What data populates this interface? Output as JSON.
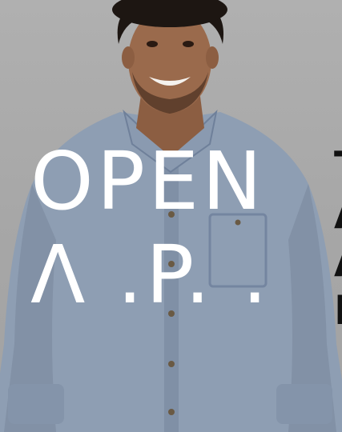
{
  "image": {
    "subject": "smiling man in denim button-up shirt",
    "background_color": "#a9a9a9",
    "shirt_color": "#8e9eb3",
    "skin_color": "#9a6a4c",
    "hair_color": "#1d1612"
  },
  "logo": {
    "line1": "OPEN",
    "line2": "Λ .P. .",
    "text_color": "#ffffff"
  },
  "edge_text": {
    "lines": [
      "T",
      "A",
      "A",
      "I"
    ]
  }
}
